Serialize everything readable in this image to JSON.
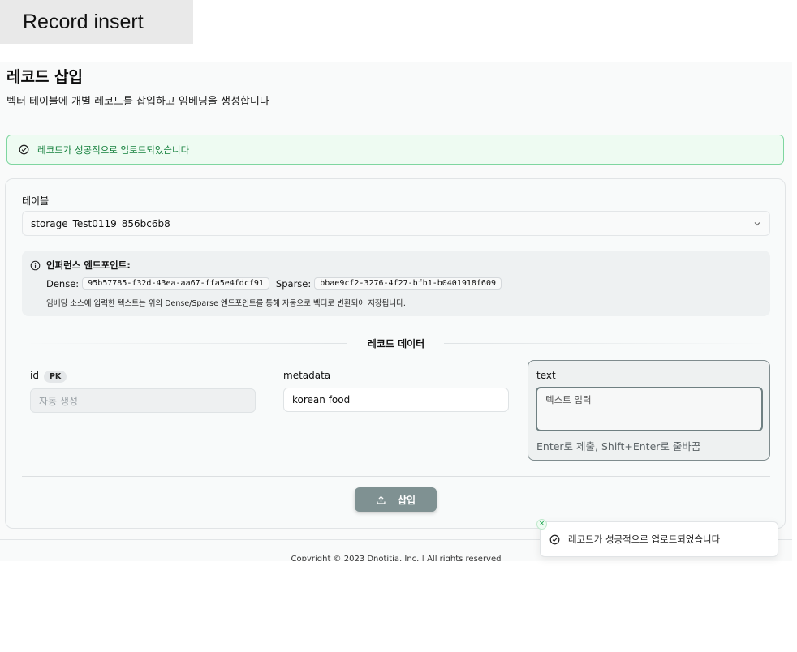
{
  "caption": "Record insert",
  "header": {
    "title": "레코드 삽입",
    "subtitle": "벡터 테이블에 개별 레코드를 삽입하고 임베딩을 생성합니다"
  },
  "alert": {
    "message": "레코드가 성공적으로 업로드되었습니다",
    "color": "#15803d"
  },
  "table_field": {
    "label": "테이블",
    "selected": "storage_Test0119_856bc6b8"
  },
  "inference": {
    "title": "인퍼런스 엔드포인트:",
    "dense_label": "Dense:",
    "dense_value": "95b57785-f32d-43ea-aa67-ffa5e4fdcf91",
    "sparse_label": "Sparse:",
    "sparse_value": "bbae9cf2-3276-4f27-bfb1-b0401918f609",
    "note": "임베딩 소스에 입력한 텍스트는 위의 Dense/Sparse 엔드포인트를 통해 자동으로 벡터로 변환되어 저장됩니다."
  },
  "record_data": {
    "section_title": "레코드 데이터",
    "fields": [
      {
        "name": "id",
        "badge": "PK",
        "value": "",
        "placeholder": "자동 생성"
      },
      {
        "name": "metadata",
        "value": "korean food"
      },
      {
        "name": "text",
        "value": "",
        "placeholder": "텍스트 입력",
        "hint": "Enter로 제출, Shift+Enter로 줄바꿈"
      }
    ]
  },
  "submit_label": "삽입",
  "footer": "Copyright © 2023 Dnotitia, Inc. | All rights reserved",
  "toast": {
    "message": "레코드가 성공적으로 업로드되었습니다",
    "close": "×"
  },
  "colors": {
    "accent": "#7f9192",
    "success": "#16a34a"
  }
}
